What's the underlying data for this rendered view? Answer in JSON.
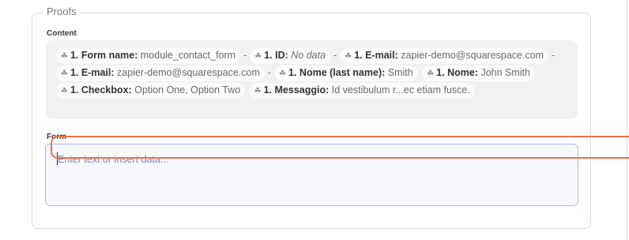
{
  "section": {
    "legend": "Proofs"
  },
  "content": {
    "label": "Content",
    "tokens": [
      {
        "key": "1. Form name:",
        "value": "module_contact_form"
      },
      {
        "key": "1. ID:",
        "value": "No data"
      },
      {
        "key": "1. E-mail:",
        "value": "zapier-demo@squarespace.com"
      },
      {
        "key": "1. E-mail:",
        "value": "zapier-demo@squarespace.com"
      },
      {
        "key": "1. Nome (last name):",
        "value": "Smith"
      },
      {
        "key": "1. Nome:",
        "value": "John Smith"
      },
      {
        "key": "1. Checkbox:",
        "value": "Option One, Option Two"
      },
      {
        "key": "1. Messaggio:",
        "value": "Id vestibulum r...ec etiam fusce."
      }
    ],
    "separator": "-"
  },
  "form": {
    "label": "Form",
    "placeholder": "Enter text or insert data..."
  },
  "icons": {
    "token_icon": "zap-icon"
  },
  "colors": {
    "accent": "#e8744a",
    "input_border": "#a9b6e2"
  }
}
